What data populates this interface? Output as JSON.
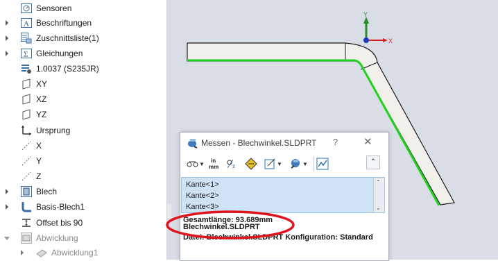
{
  "tree": {
    "items": [
      {
        "label": "Sensoren",
        "icon": "sensor-icon",
        "expander": false
      },
      {
        "label": "Beschriftungen",
        "icon": "annotation-icon",
        "expander": true
      },
      {
        "label": "Zuschnittsliste(1)",
        "icon": "cutlist-icon",
        "expander": true
      },
      {
        "label": "Gleichungen",
        "icon": "equation-icon",
        "expander": true
      },
      {
        "label": "1.0037 (S235JR)",
        "icon": "material-icon",
        "expander": false
      },
      {
        "label": "XY",
        "icon": "plane-icon",
        "expander": false
      },
      {
        "label": "XZ",
        "icon": "plane-icon",
        "expander": false
      },
      {
        "label": "YZ",
        "icon": "plane-icon",
        "expander": false
      },
      {
        "label": "Ursprung",
        "icon": "origin-icon",
        "expander": false
      },
      {
        "label": "X",
        "icon": "axis-icon",
        "expander": false
      },
      {
        "label": "Y",
        "icon": "axis-icon",
        "expander": false
      },
      {
        "label": "Z",
        "icon": "axis-icon",
        "expander": false
      },
      {
        "label": "Blech",
        "icon": "sheetmetal-icon",
        "expander": true
      },
      {
        "label": "Basis-Blech1",
        "icon": "base-flange-icon",
        "expander": true
      },
      {
        "label": "Offset bis 90",
        "icon": "offset-icon",
        "expander": false
      },
      {
        "label": "Abwicklung",
        "icon": "flatpattern-icon",
        "expander": true
      },
      {
        "label": "Abwicklung1",
        "icon": "flatpattern-sub-icon",
        "expander": true
      }
    ]
  },
  "viewport": {
    "axis_y": "Y",
    "axis_x": "X",
    "edge_color": "#22d11e"
  },
  "dialog": {
    "title": "Messen - Blechwinkel.SLDPRT",
    "help": "?",
    "close": "✕",
    "toolbar": {
      "units": "in\nmm"
    },
    "selections": [
      "Kante<1>",
      "Kante<2>",
      "Kante<3>"
    ],
    "result_lines": [
      "Gesamtlänge: 93.689mm",
      "Blechwinkel.SLDPRT",
      "Datei: Blechwinkel.SLDPRT Konfiguration: Standard"
    ]
  },
  "highlight_color": "#e0121b"
}
